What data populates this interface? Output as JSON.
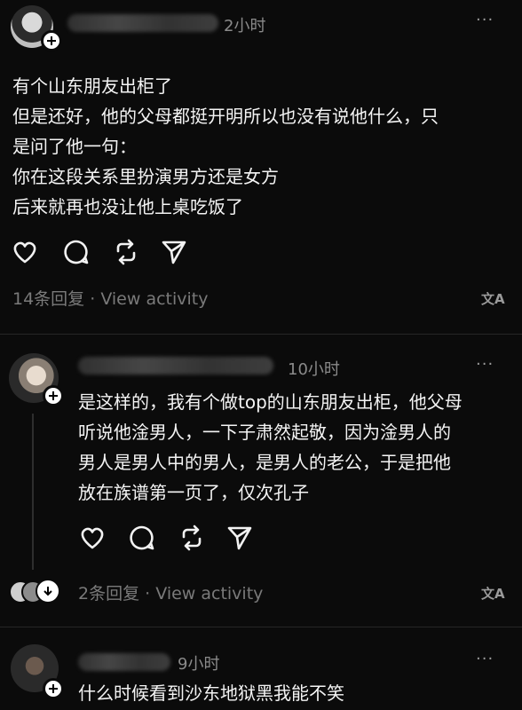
{
  "post1": {
    "time": "2小时",
    "more": "···",
    "lines": [
      "有个山东朋友出柜了",
      "但是还好，他的父母都挺开明所以也没有说他什么，只",
      "是问了他一句：",
      "你在这段关系里扮演男方还是女方",
      "后来就再也没让他上桌吃饭了"
    ],
    "replies": "14条回复",
    "sep": "·",
    "activity": "View activity",
    "translate": "文A"
  },
  "post2": {
    "time": "10小时",
    "more": "···",
    "lines": [
      "是这样的，我有个做top的山东朋友出柜，他父母",
      "听说他淦男人，一下子肃然起敬，因为淦男人的",
      "男人是男人中的男人，是男人的老公，于是把他",
      "放在族谱第一页了，仅次孔子"
    ],
    "replies": "2条回复",
    "sep": "·",
    "activity": "View activity",
    "translate": "文A"
  },
  "post3": {
    "time": "9小时",
    "more": "···",
    "lines": [
      "什么时候看到沙东地狱黑我能不笑"
    ]
  },
  "colors": {
    "background": "#0b0b0b",
    "text": "#f4f4f4",
    "muted": "#7a7a7a"
  },
  "icons": [
    "heart-icon",
    "comment-icon",
    "repost-icon",
    "share-icon",
    "plus-icon",
    "translate-icon"
  ]
}
